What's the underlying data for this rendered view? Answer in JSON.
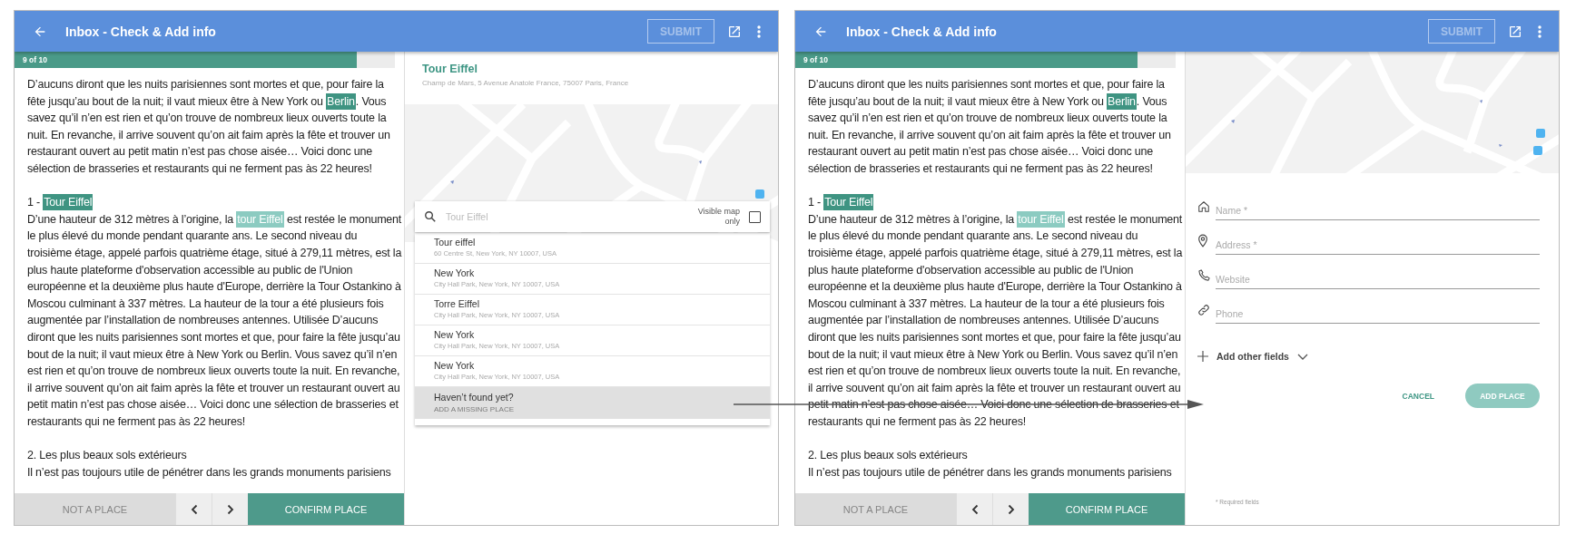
{
  "screens": [
    {
      "header": {
        "title": "Inbox - Check & Add info",
        "submit": {
          "label": "SUBMIT",
          "disabled": true
        }
      },
      "progress": {
        "label": "9 of 10",
        "level": 0.9
      },
      "article": {
        "blocks": [
          {
            "kind": "para",
            "segments": [
              {
                "text": "D’aucuns diront que les nuits parisiennes sont mortes et que, pour faire la fête jusqu’au bout de la nuit; il vaut mieux être à New York ou "
              },
              {
                "text": "Berlin",
                "highlighted": true,
                "active": true
              },
              {
                "text": ". Vous savez qu’il n’en est rien et qu’on trouve de nombreux lieux ouverts toute la nuit. En revanche, il arrive souvent qu’on ait faim après la fête et trouver un restaurant ouvert au petit matin n’est pas chose aisée… Voici donc une sélection de brasseries et restaurants qui ne ferment pas às 22 heures!"
              }
            ]
          },
          {
            "kind": "heading",
            "segments": [
              {
                "text": "1 - "
              },
              {
                "text": "Tour Eiffel",
                "highlighted": true,
                "active": true
              }
            ]
          },
          {
            "kind": "para",
            "segments": [
              {
                "text": "D’une hauteur de 312 mètres à l’origine, la "
              },
              {
                "text": "tour Eiffel",
                "highlighted": true,
                "active": false
              },
              {
                "text": " est restée le monument le plus élevé du monde pendant quarante ans. Le second niveau du troisième étage, appelé parfois quatrième étage, situé à 279,11 mètres, est la plus haute plateforme d'observation accessible au public de l'Union européenne et la deuxième plus haute d'Europe, derrière la Tour Ostankino à Moscou culminant à 337 mètres. La hauteur de la tour a été plusieurs fois augmentée par l’installation de nombreuses antennes. Utilisée D’aucuns diront que les nuits parisiennes sont mortes et que, pour faire la fête jusqu’au bout de la nuit; il vaut mieux être à New York ou Berlin. Vous savez qu’il n’en est rien et qu’on trouve de nombreux lieux ouverts toute la nuit. En revanche, il arrive souvent qu’on ait faim après la fête et trouver un restaurant ouvert au petit matin n’est pas chose aisée… Voici donc une sélection de brasseries et restaurants qui ne ferment pas às 22 heures!"
              }
            ]
          },
          {
            "kind": "heading",
            "segments": [
              {
                "text": "2. Les plus beaux sols extérieurs"
              }
            ]
          },
          {
            "kind": "para",
            "segments": [
              {
                "text": "Il n’est pas toujours utile de pénétrer dans les grands monuments parisiens"
              }
            ]
          }
        ]
      },
      "footer": {
        "reject": {
          "label": "NOT A PLACE",
          "disabled": true
        },
        "confirm": {
          "label": "CONFIRM PLACE",
          "disabled": false
        }
      },
      "panel": {
        "kind": "search",
        "place": {
          "name": "Tour Eiffel",
          "address": "Champ de Mars, 5 Avenue Anatole France, 75007 Paris, France"
        },
        "search": {
          "placeholder": "Tour Eiffel"
        },
        "visible_map_only": {
          "label": "Visible map only",
          "checked": false
        },
        "results": [
          {
            "name": "Tour eiffel",
            "address": "60 Centre St, New York, NY 10007, USA"
          },
          {
            "name": "New York",
            "address": "City Hall Park, New York, NY 10007, USA"
          },
          {
            "name": "Torre Eiffel",
            "address": "City Hall Park, New York, NY 10007, USA"
          },
          {
            "name": "New York",
            "address": "City Hall Park, New York, NY 10007, USA"
          },
          {
            "name": "New York",
            "address": "City Hall Park, New York, NY 10007, USA"
          }
        ],
        "missing": {
          "title": "Haven’t found yet?",
          "action": "ADD A MISSING PLACE"
        }
      }
    },
    {
      "header": {
        "title": "Inbox - Check & Add info",
        "submit": {
          "label": "SUBMIT",
          "disabled": true
        }
      },
      "progress": {
        "label": "9 of 10",
        "level": 0.9
      },
      "article": {
        "blocks": [
          {
            "kind": "para",
            "segments": [
              {
                "text": "D’aucuns diront que les nuits parisiennes sont mortes et que, pour faire la fête jusqu’au bout de la nuit; il vaut mieux être à New York ou "
              },
              {
                "text": "Berlin",
                "highlighted": true,
                "active": true
              },
              {
                "text": ". Vous savez qu’il n’en est rien et qu’on trouve de nombreux lieux ouverts toute la nuit. En revanche, il arrive souvent qu’on ait faim après la fête et trouver un restaurant ouvert au petit matin n’est pas chose aisée… Voici donc une sélection de brasseries et restaurants qui ne ferment pas às 22 heures!"
              }
            ]
          },
          {
            "kind": "heading",
            "segments": [
              {
                "text": "1 - "
              },
              {
                "text": "Tour Eiffel",
                "highlighted": true,
                "active": true
              }
            ]
          },
          {
            "kind": "para",
            "segments": [
              {
                "text": "D’une hauteur de 312 mètres à l’origine, la "
              },
              {
                "text": "tour Eiffel",
                "highlighted": true,
                "active": false
              },
              {
                "text": " est restée le monument le plus élevé du monde pendant quarante ans. Le second niveau du troisième étage, appelé parfois quatrième étage, situé à 279,11 mètres, est la plus haute plateforme d'observation accessible au public de l'Union européenne et la deuxième plus haute d'Europe, derrière la Tour Ostankino à Moscou culminant à 337 mètres. La hauteur de la tour a été plusieurs fois augmentée par l’installation de nombreuses antennes. Utilisée D’aucuns diront que les nuits parisiennes sont mortes et que, pour faire la fête jusqu’au bout de la nuit; il vaut mieux être à New York ou Berlin. Vous savez qu’il n’en est rien et qu’on trouve de nombreux lieux ouverts toute la nuit. En revanche, il arrive souvent qu’on ait faim après la fête et trouver un restaurant ouvert au petit matin n’est pas chose aisée… Voici donc une sélection de brasseries et restaurants qui ne ferment pas às 22 heures!"
              }
            ]
          },
          {
            "kind": "heading",
            "segments": [
              {
                "text": "2. Les plus beaux sols extérieurs"
              }
            ]
          },
          {
            "kind": "para",
            "segments": [
              {
                "text": "Il n’est pas toujours utile de pénétrer dans les grands monuments parisiens"
              }
            ]
          }
        ]
      },
      "footer": {
        "reject": {
          "label": "NOT A PLACE",
          "disabled": true
        },
        "confirm": {
          "label": "CONFIRM PLACE",
          "disabled": false
        }
      },
      "panel": {
        "kind": "form",
        "fields": [
          {
            "placeholder": "Name *"
          },
          {
            "placeholder": "Address *"
          },
          {
            "placeholder": "Website"
          },
          {
            "placeholder": "Phone"
          }
        ],
        "more": {
          "label": "Add other fields",
          "expanded": false
        },
        "cancel": {
          "label": "CANCEL"
        },
        "add": {
          "label": "ADD PLACE",
          "disabled": true
        },
        "note": "* Required fields"
      }
    }
  ]
}
